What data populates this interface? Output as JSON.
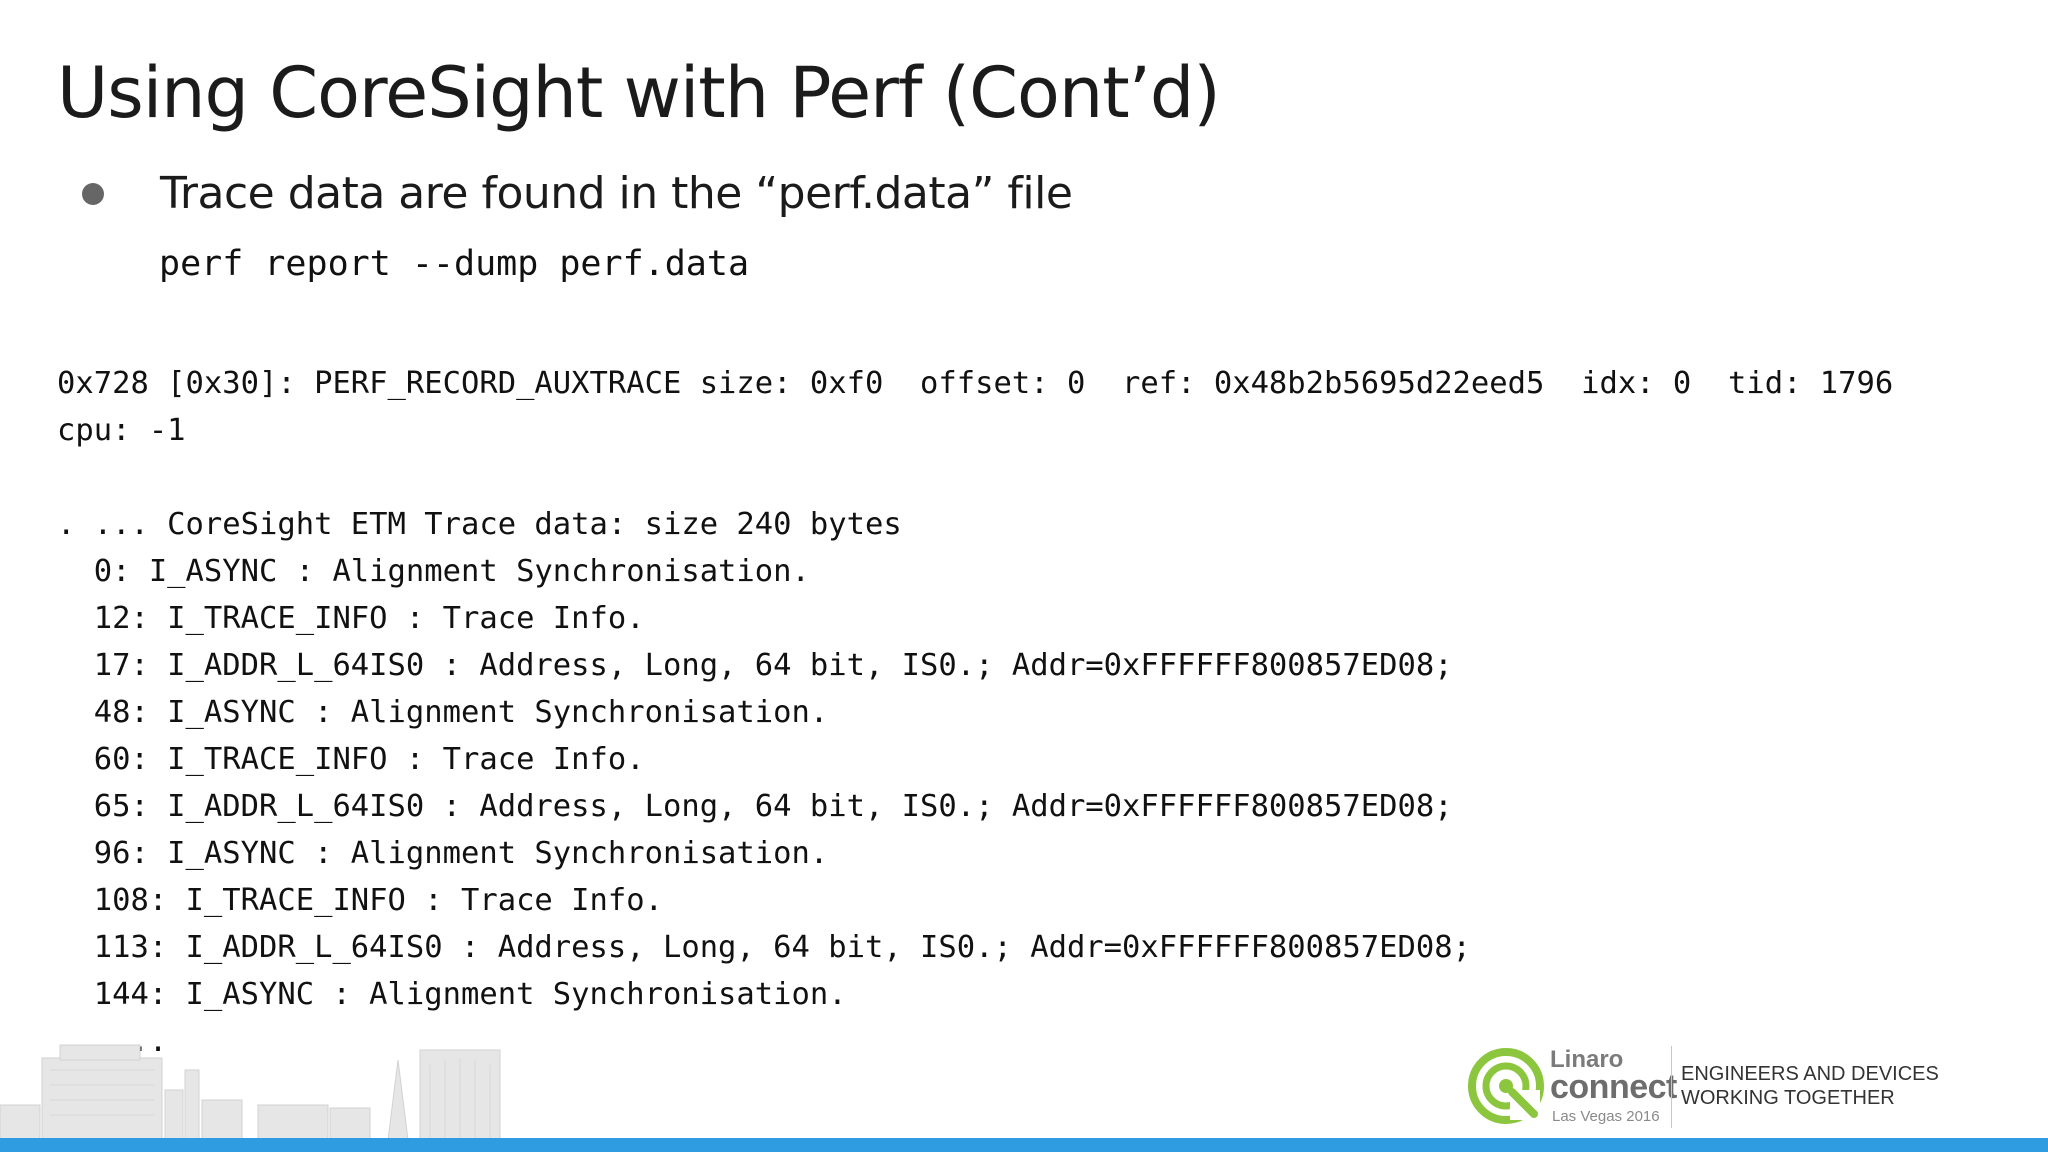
{
  "slide": {
    "title": "Using CoreSight with Perf (Cont’d)",
    "bullet": "Trace data are found in the “perf.data” file",
    "command": "perf report --dump perf.data"
  },
  "dump": {
    "lines": [
      "0x728 [0x30]: PERF_RECORD_AUXTRACE size: 0xf0  offset: 0  ref: 0x48b2b5695d22eed5  idx: 0  tid: 1796",
      "cpu: -1",
      "",
      ". ... CoreSight ETM Trace data: size 240 bytes",
      "  0: I_ASYNC : Alignment Synchronisation.",
      "  12: I_TRACE_INFO : Trace Info.",
      "  17: I_ADDR_L_64IS0 : Address, Long, 64 bit, IS0.; Addr=0xFFFFFF800857ED08;",
      "  48: I_ASYNC : Alignment Synchronisation.",
      "  60: I_TRACE_INFO : Trace Info.",
      "  65: I_ADDR_L_64IS0 : Address, Long, 64 bit, IS0.; Addr=0xFFFFFF800857ED08;",
      "  96: I_ASYNC : Alignment Synchronisation.",
      "  108: I_TRACE_INFO : Trace Info.",
      "  113: I_ADDR_L_64IS0 : Address, Long, 64 bit, IS0.; Addr=0xFFFFFF800857ED08;",
      "  144: I_ASYNC : Alignment Synchronisation.",
      "  ...."
    ]
  },
  "footer": {
    "logo_linaro": "Linaro",
    "logo_connect": "connect",
    "logo_event": "Las Vegas 2016",
    "tagline_line1": "ENGINEERS AND DEVICES",
    "tagline_line2": "WORKING TOGETHER",
    "accent_color": "#2f9be0",
    "logo_green": "#8cc63f"
  }
}
